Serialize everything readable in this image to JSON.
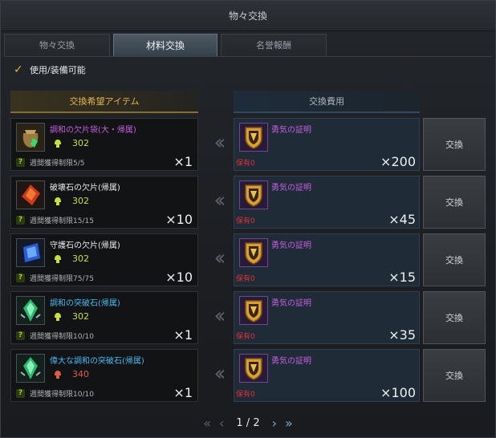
{
  "window": {
    "title": "物々交換"
  },
  "tabs": [
    {
      "label": "物々交換"
    },
    {
      "label": "材料交換"
    },
    {
      "label": "名誉報酬"
    }
  ],
  "filter": {
    "label": "使用/装備可能",
    "checked": true
  },
  "columns": {
    "wanted": "交換希望アイテム",
    "cost": "交換費用"
  },
  "rows": [
    {
      "item_name": "調和の欠片袋(大・帰属)",
      "name_color": "#c65ee0",
      "icon": "pouch-icon",
      "stat_value": "302",
      "stat_color": "#c7e040",
      "limit_text": "週間獲得制限5/5",
      "quantity": "×1",
      "cost_name": "勇気の証明",
      "cost_owned": "保有0",
      "cost_quantity": "×200",
      "button_label": "交換"
    },
    {
      "item_name": "破壊石の欠片(帰属)",
      "name_color": "#e8eaed",
      "icon": "red-stone-icon",
      "stat_value": "302",
      "stat_color": "#c7e040",
      "limit_text": "週間獲得制限15/15",
      "quantity": "×10",
      "cost_name": "勇気の証明",
      "cost_owned": "保有0",
      "cost_quantity": "×45",
      "button_label": "交換"
    },
    {
      "item_name": "守護石の欠片(帰属)",
      "name_color": "#e8eaed",
      "icon": "blue-stone-icon",
      "stat_value": "302",
      "stat_color": "#c7e040",
      "limit_text": "週間獲得制限75/75",
      "quantity": "×10",
      "cost_name": "勇気の証明",
      "cost_owned": "保有0",
      "cost_quantity": "×15",
      "button_label": "交換"
    },
    {
      "item_name": "調和の突破石(帰属)",
      "name_color": "#4ab8f0",
      "icon": "green-crystal-icon",
      "stat_value": "302",
      "stat_color": "#c7e040",
      "limit_text": "週間獲得制限10/10",
      "quantity": "×1",
      "cost_name": "勇気の証明",
      "cost_owned": "保有0",
      "cost_quantity": "×35",
      "button_label": "交換"
    },
    {
      "item_name": "偉大な調和の突破石(帰属)",
      "name_color": "#4ab8f0",
      "icon": "green-crystal-icon",
      "stat_value": "340",
      "stat_color": "#e05a4a",
      "limit_text": "週間獲得制限10/10",
      "quantity": "×1",
      "cost_name": "勇気の証明",
      "cost_owned": "保有0",
      "cost_quantity": "×100",
      "button_label": "交換"
    }
  ],
  "pagination": {
    "current": "1",
    "total": "2",
    "text": "1 / 2"
  }
}
